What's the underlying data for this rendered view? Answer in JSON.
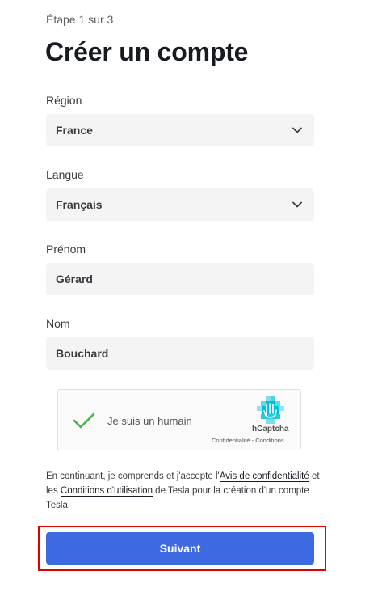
{
  "header": {
    "step": "Étape 1 sur 3",
    "title": "Créer un compte"
  },
  "form": {
    "region": {
      "label": "Région",
      "value": "France"
    },
    "language": {
      "label": "Langue",
      "value": "Français"
    },
    "first_name": {
      "label": "Prénom",
      "value": "Gérard"
    },
    "last_name": {
      "label": "Nom",
      "value": "Bouchard"
    }
  },
  "captcha": {
    "label": "Je suis un humain",
    "brand": "hCaptcha",
    "links": "Confidentialité - Conditions",
    "checked": true,
    "check_color": "#4caf50",
    "logo_color": "#00bfd8"
  },
  "legal": {
    "part1": "En continuant, je comprends et j'accepte l'",
    "privacy_link": "Avis de confidentialité",
    "part2": " et les ",
    "terms_link": "Conditions d'utilisation",
    "part3": " de Tesla pour la création d'un compte Tesla"
  },
  "actions": {
    "next_label": "Suivant",
    "next_color": "#3e6ae1",
    "highlight_color": "#e00000"
  }
}
